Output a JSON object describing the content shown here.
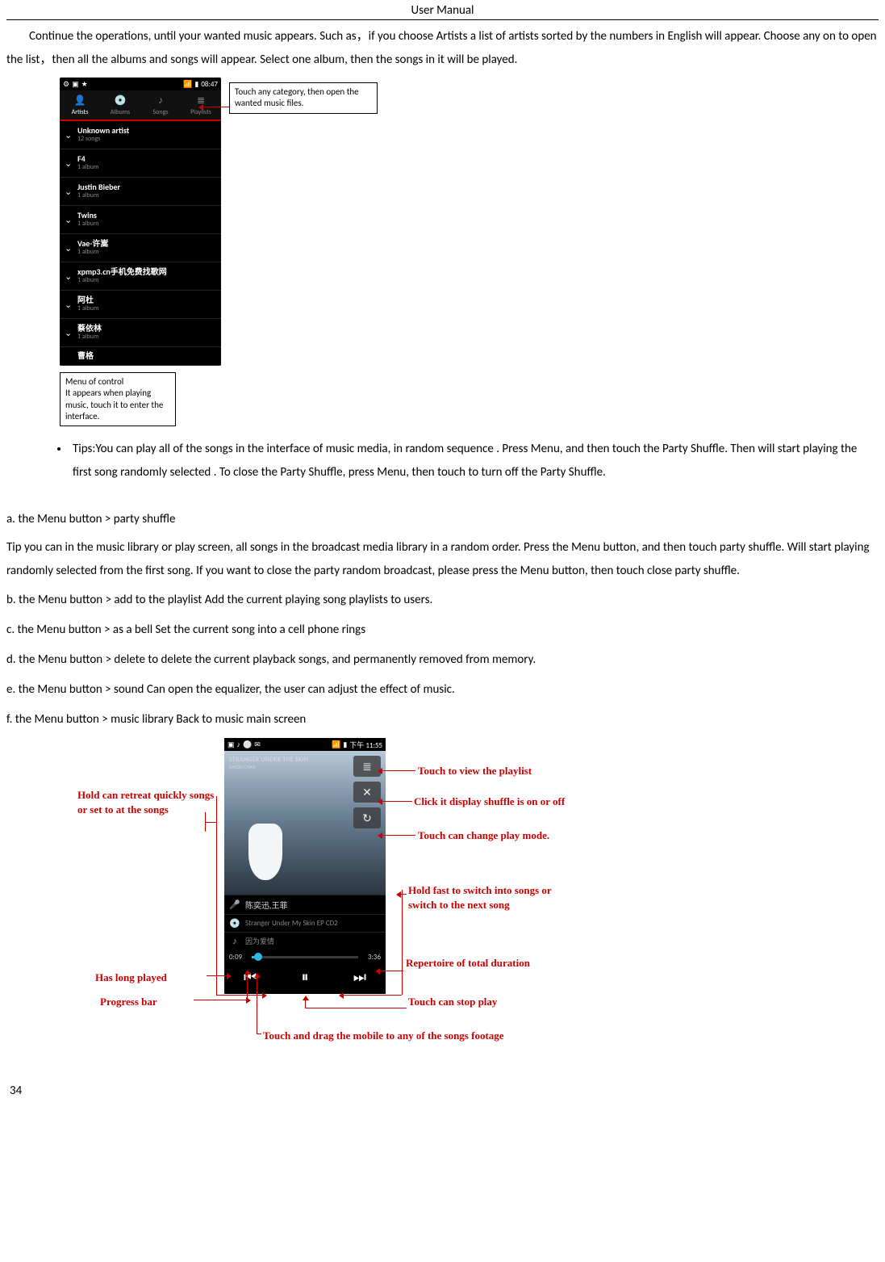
{
  "header": "User    Manual",
  "intro": "Continue the operations, until your wanted music appears. Such as，if you choose Artists a list of artists sorted by the numbers in English will appear. Choose any on to open the list，then all the albums and songs will appear. Select one album, then the songs in it will be played.",
  "screenshot1": {
    "status_time": "08:47",
    "tabs": [
      {
        "icon": "👤",
        "label": "Artists"
      },
      {
        "icon": "💿",
        "label": "Albums"
      },
      {
        "icon": "♪",
        "label": "Songs"
      },
      {
        "icon": "≣",
        "label": "Playlists"
      }
    ],
    "artists": [
      {
        "name": "Unknown artist",
        "meta": "12 songs"
      },
      {
        "name": "F4",
        "meta": "1 album"
      },
      {
        "name": "Justin Bieber",
        "meta": "1 album"
      },
      {
        "name": "Twins",
        "meta": "1 album"
      },
      {
        "name": "Vae-许嵩",
        "meta": "1 album"
      },
      {
        "name": "xpmp3.cn手机免费找歌网",
        "meta": "1 album"
      },
      {
        "name": "阿杜",
        "meta": "1 album"
      },
      {
        "name": "蔡依林",
        "meta": "1 album"
      },
      {
        "name": "曹格",
        "meta": ""
      }
    ],
    "callout_tabbar": "Touch any category, then open the wanted music files.",
    "menu_control_title": "Menu of control",
    "menu_control_body": "It appears when playing music, touch it to enter the interface."
  },
  "tips": "Tips:You can play all of the songs in the interface of    music media, in random sequence    . Press    Menu, and then touch the Party Shuffle. Then will start playing the first song randomly selected . To close the Party Shuffle, press Menu, then touch to turn off the Party Shuffle.",
  "menu": {
    "a_title": "a. the Menu button > party shuffle",
    "a_tip": "Tip you can in the music library or play screen, all songs in the broadcast media library in a random order. Press the Menu button, and then touch party shuffle. Will start playing randomly selected from the first song. If you want to close the party random broadcast, please press the Menu button, then touch close party shuffle.",
    "b": "b. the Menu button > add to the playlist Add the current playing song playlists to users.",
    "c": "c. the Menu button > as a bell Set the current song into a cell phone rings",
    "d": "d. the Menu button > delete to delete the current playback songs, and permanently removed from memory.",
    "e": "e. the Menu button > sound Can open the equalizer, the user can adjust the effect of music.",
    "f": "f. the Menu button > music library Back to music main screen"
  },
  "player": {
    "status_time": "下午 11:55",
    "album_title": "STRANGER UNDER THE SKIN",
    "album_sub": "EASON CHAN",
    "artist_line": "陈奕迅,王菲",
    "album_line": "Stranger Under My Skin EP CD2",
    "song_line": "因为爱情",
    "time_elapsed": "0:09",
    "time_total": "3:36"
  },
  "callouts": {
    "playlist": "Touch to view the playlist",
    "shuffle": "Click it display shuffle is on or off",
    "playmode": "Touch can change play mode.",
    "fastswitch": "Hold fast to switch into songs or switch to the next song",
    "retreat": "Hold can retreat quickly songs or set to at the songs",
    "totalduration": "Repertoire of total duration",
    "hasplayed": "Has long played",
    "progressbar": "Progress bar",
    "stopplay": "Touch can stop play",
    "dragfootage": "Touch and drag the mobile to any of the songs footage"
  },
  "page_number": "34"
}
